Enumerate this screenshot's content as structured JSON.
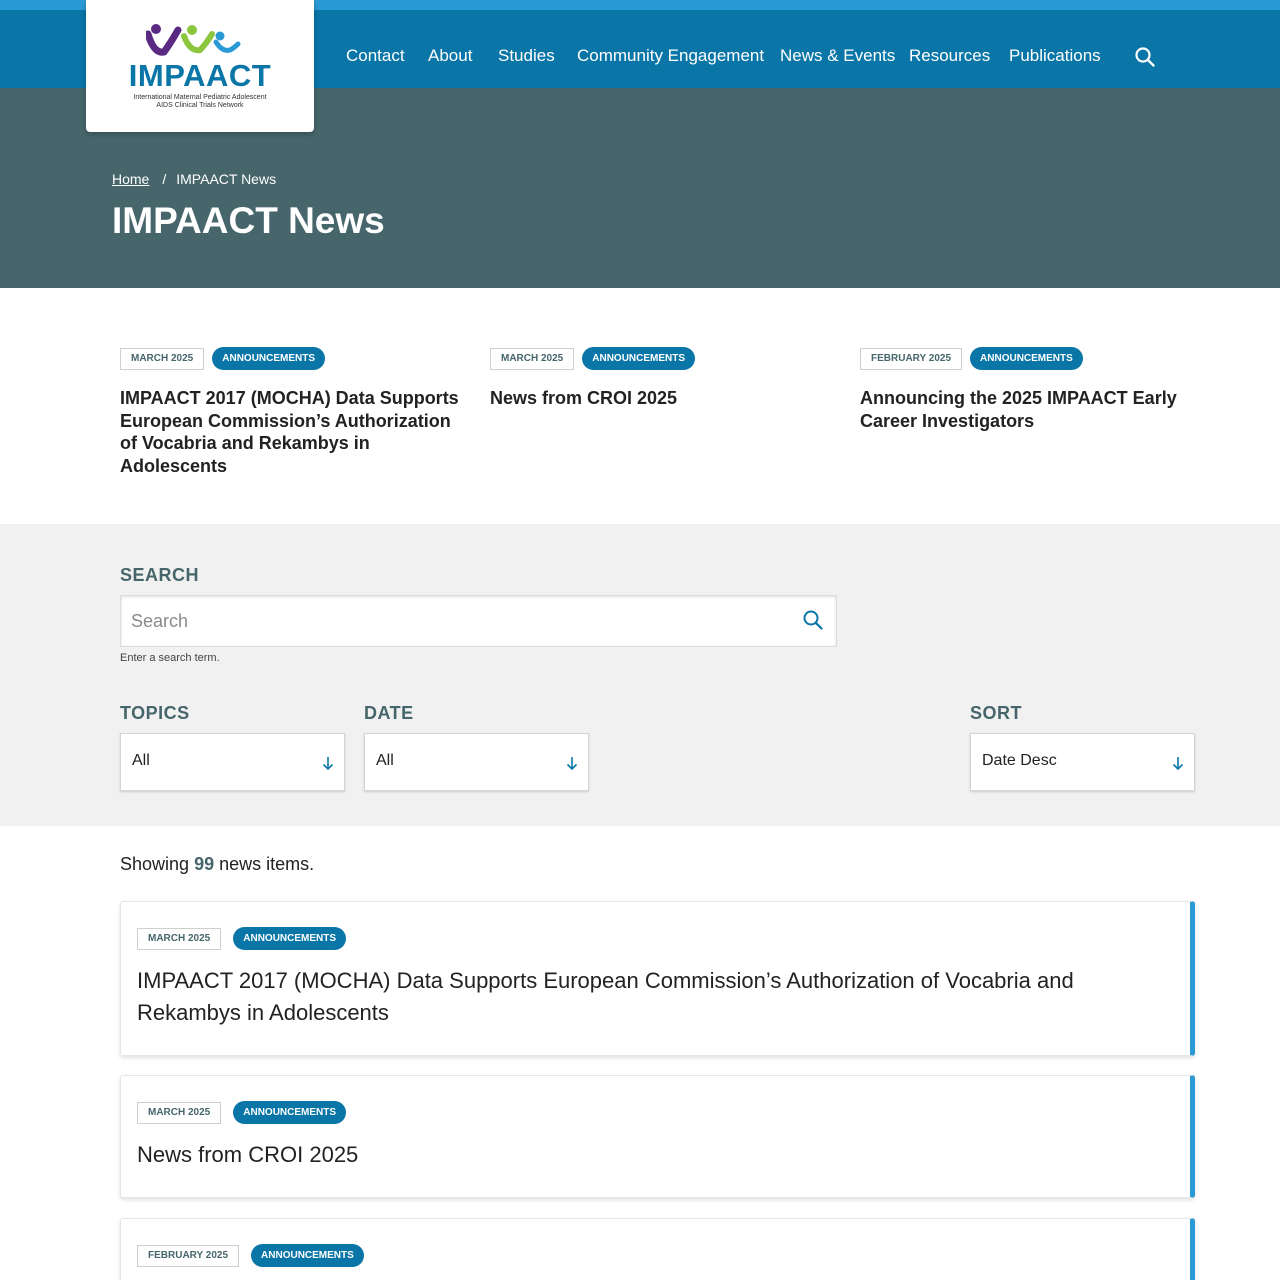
{
  "header": {
    "logo": {
      "wordmark": "IMPAACT",
      "subtitle_line1": "International Maternal Pediatric Adolescent",
      "subtitle_line2": "AIDS Clinical Trials Network"
    },
    "nav": [
      "Contact",
      "About",
      "Studies",
      "Community Engagement",
      "News & Events",
      "Resources",
      "Publications"
    ],
    "search_icon": "search-icon"
  },
  "hero": {
    "breadcrumb": {
      "home": "Home",
      "separator": "/",
      "current": "IMPAACT News"
    },
    "title": "IMPAACT News"
  },
  "featured": [
    {
      "date": "March 2025",
      "category": "Announcements",
      "title": "IMPAACT 2017 (MOCHA) Data Supports European Commission’s Authorization of Vocabria and Rekambys in Adolescents"
    },
    {
      "date": "March 2025",
      "category": "Announcements",
      "title": "News from CROI 2025"
    },
    {
      "date": "February 2025",
      "category": "Announcements",
      "title": "Announcing the 2025 IMPAACT Early Career Investigators"
    }
  ],
  "filters": {
    "search_label": "SEARCH",
    "search_placeholder": "Search",
    "search_value": "",
    "search_hint": "Enter a search term.",
    "topics_label": "TOPICS",
    "topics_value": "All",
    "date_label": "DATE",
    "date_value": "All",
    "sort_label": "SORT",
    "sort_value": "Date Desc"
  },
  "results": {
    "prefix": "Showing",
    "count": "99",
    "suffix": "news items.",
    "items": [
      {
        "date": "March 2025",
        "category": "Announcements",
        "title": "IMPAACT 2017 (MOCHA) Data Supports European Commission’s Authorization of Vocabria and Rekambys in Adolescents"
      },
      {
        "date": "March 2025",
        "category": "Announcements",
        "title": "News from CROI 2025"
      },
      {
        "date": "February 2025",
        "category": "Announcements",
        "title": ""
      }
    ]
  },
  "colors": {
    "primary_blue": "#0a76a8",
    "accent_blue": "#2a9ad6",
    "slate": "#46666c",
    "filter_bg": "#f1f1f1",
    "logo_purple": "#5a2a82",
    "logo_green": "#8cc63f"
  }
}
